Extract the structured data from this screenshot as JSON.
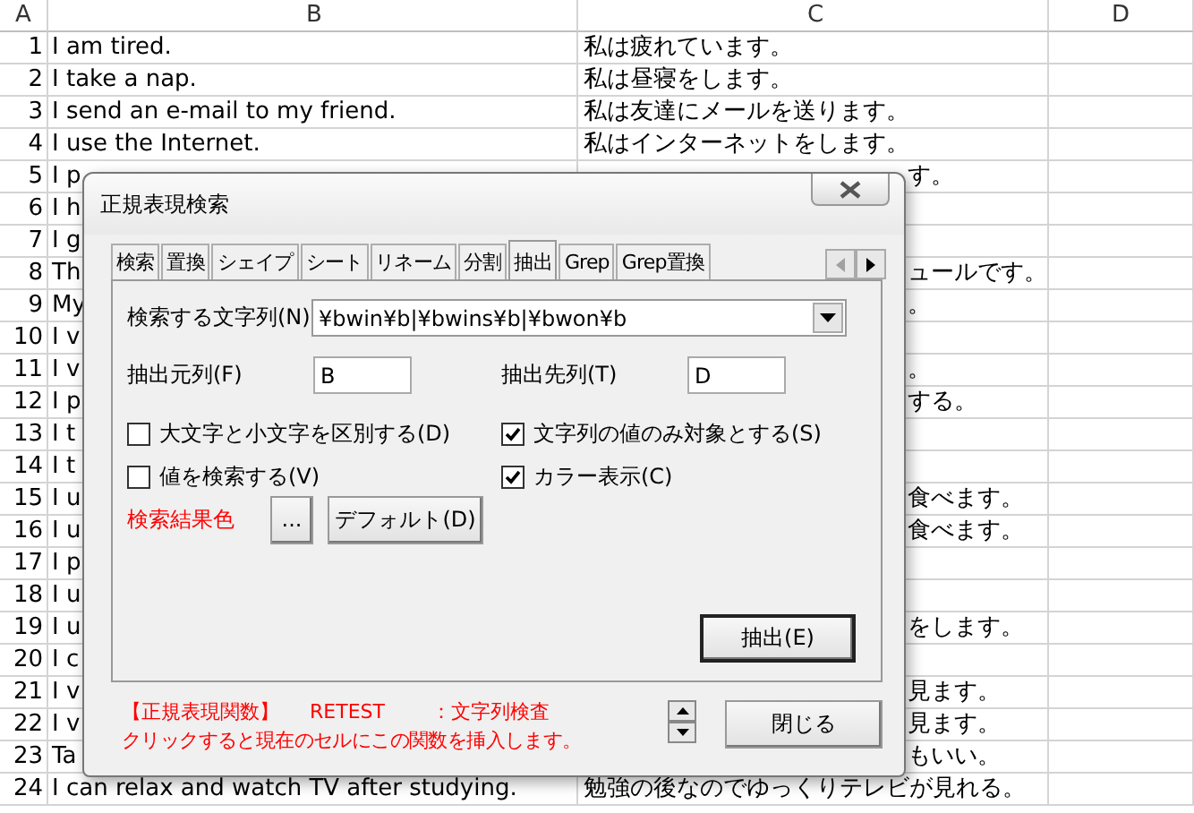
{
  "sheet": {
    "columns": [
      "A",
      "B",
      "C",
      "D"
    ],
    "rows": [
      {
        "num": "1",
        "b": "I am tired.",
        "c": "私は疲れています。"
      },
      {
        "num": "2",
        "b": "I take a nap.",
        "c": "私は昼寝をします。"
      },
      {
        "num": "3",
        "b": "I send an e-mail to my friend.",
        "c": "私は友達にメールを送ります。"
      },
      {
        "num": "4",
        "b": "I use the Internet.",
        "c": "私はインターネットをします。"
      },
      {
        "num": "5",
        "b": "I p",
        "c": "す。"
      },
      {
        "num": "6",
        "b": "I h",
        "c": ""
      },
      {
        "num": "7",
        "b": "I g",
        "c": ""
      },
      {
        "num": "8",
        "b": "Th",
        "c": "ュールです。"
      },
      {
        "num": "9",
        "b": "My",
        "c": "。"
      },
      {
        "num": "10",
        "b": "I v",
        "c": ""
      },
      {
        "num": "11",
        "b": "I v",
        "c": "。"
      },
      {
        "num": "12",
        "b": "I p",
        "c": "する。"
      },
      {
        "num": "13",
        "b": "I t",
        "c": ""
      },
      {
        "num": "14",
        "b": "I t",
        "c": ""
      },
      {
        "num": "15",
        "b": "I u",
        "c": "食べます。"
      },
      {
        "num": "16",
        "b": "I u",
        "c": "食べます。"
      },
      {
        "num": "17",
        "b": "I p",
        "c": ""
      },
      {
        "num": "18",
        "b": "I u",
        "c": ""
      },
      {
        "num": "19",
        "b": "I u",
        "c": "をします。"
      },
      {
        "num": "20",
        "b": "I c",
        "c": ""
      },
      {
        "num": "21",
        "b": "I v",
        "c": "見ます。"
      },
      {
        "num": "22",
        "b": "I v",
        "c": "見ます。"
      },
      {
        "num": "23",
        "b": "Ta",
        "c": "もいい。"
      },
      {
        "num": "24",
        "b": "I can relax and watch TV after studying.",
        "c": "勉強の後なのでゆっくりテレビが見れる。"
      }
    ]
  },
  "dialog": {
    "title": "正規表現検索",
    "tabs": [
      {
        "label": "検索",
        "selected": false
      },
      {
        "label": "置換",
        "selected": false
      },
      {
        "label": "シェイプ",
        "selected": false
      },
      {
        "label": "シート",
        "selected": false
      },
      {
        "label": "リネーム",
        "selected": false
      },
      {
        "label": "分割",
        "selected": false
      },
      {
        "label": "抽出",
        "selected": true
      },
      {
        "label": "Grep",
        "selected": false
      },
      {
        "label": "Grep置換",
        "selected": false
      }
    ],
    "tab_scroll": {
      "left_disabled": true
    },
    "search_label": "検索する文字列(N)",
    "search_value": "¥bwin¥b|¥bwins¥b|¥bwon¥b",
    "source_label": "抽出元列(F)",
    "source_value": "B",
    "dest_label": "抽出先列(T)",
    "dest_value": "D",
    "checkboxes": [
      {
        "label": "大文字と小文字を区別する(D)",
        "checked": false
      },
      {
        "label": "文字列の値のみ対象とする(S)",
        "checked": true
      },
      {
        "label": "値を検索する(V)",
        "checked": false
      },
      {
        "label": "カラー表示(C)",
        "checked": true
      }
    ],
    "color_label": "検索結果色",
    "color_button": "...",
    "default_button": "デフォルト(D)",
    "extract_button": "抽出(E)",
    "footer": {
      "function_heading": "【正規表現関数】",
      "function_name": "RETEST",
      "function_desc": "：文字列検査",
      "hint": "クリックすると現在のセルにこの関数を挿入します。"
    },
    "close_button": "閉じる"
  }
}
